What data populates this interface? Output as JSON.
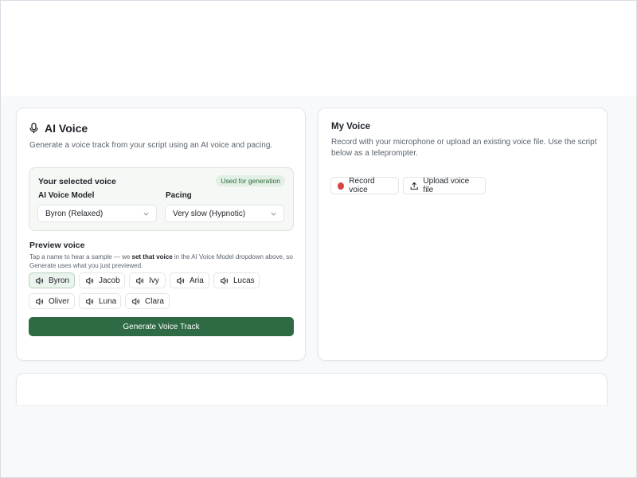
{
  "colors": {
    "accent": "#2e6b44",
    "badge_bg": "#e2efe4",
    "badge_text": "#2f6b3f",
    "record": "#d64545",
    "page_bg": "#f8f9fb"
  },
  "ai_voice": {
    "icon": "microphone-icon",
    "title": "AI Voice",
    "description": "Generate a voice track from your script using an AI voice and pacing.",
    "selected_voice": {
      "title": "Your selected voice",
      "badge": "Used for generation",
      "model_label": "AI Voice Model",
      "model_value": "Byron (Relaxed)",
      "pacing_label": "Pacing",
      "pacing_value": "Very slow (Hypnotic)"
    },
    "preview": {
      "title": "Preview voice",
      "desc_part1": "Tap a name to hear a sample — we ",
      "desc_bold": "set that voice",
      "desc_part2": " in the AI Voice Model dropdown above, so Generate uses what you just previewed.",
      "voices": [
        {
          "name": "Byron",
          "active": true
        },
        {
          "name": "Jacob",
          "active": false
        },
        {
          "name": "Ivy",
          "active": false
        },
        {
          "name": "Aria",
          "active": false
        },
        {
          "name": "Lucas",
          "active": false
        },
        {
          "name": "Oliver",
          "active": false
        },
        {
          "name": "Luna",
          "active": false
        },
        {
          "name": "Clara",
          "active": false
        }
      ]
    },
    "generate_label": "Generate Voice Track"
  },
  "my_voice": {
    "title": "My Voice",
    "description": "Record with your microphone or upload an existing voice file. Use the script below as a teleprompter.",
    "record_label": "Record voice",
    "upload_label": "Upload voice file",
    "upload_icon": "upload-icon"
  }
}
